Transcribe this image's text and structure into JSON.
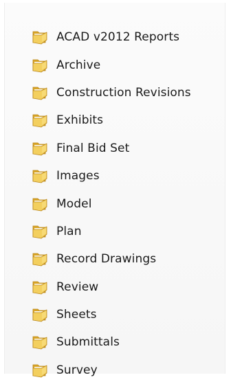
{
  "folders": [
    {
      "name": "ACAD v2012 Reports",
      "icon": "folder-icon"
    },
    {
      "name": "Archive",
      "icon": "folder-icon"
    },
    {
      "name": "Construction Revisions",
      "icon": "folder-icon"
    },
    {
      "name": "Exhibits",
      "icon": "folder-icon"
    },
    {
      "name": "Final Bid Set",
      "icon": "folder-icon"
    },
    {
      "name": "Images",
      "icon": "folder-icon"
    },
    {
      "name": "Model",
      "icon": "folder-icon"
    },
    {
      "name": "Plan",
      "icon": "folder-icon"
    },
    {
      "name": "Record Drawings",
      "icon": "folder-icon"
    },
    {
      "name": "Review",
      "icon": "folder-icon"
    },
    {
      "name": "Sheets",
      "icon": "folder-icon"
    },
    {
      "name": "Submittals",
      "icon": "folder-icon"
    },
    {
      "name": "Survey",
      "icon": "folder-icon"
    }
  ],
  "colors": {
    "folder_back": "#d9a527",
    "folder_front": "#f3cf5e",
    "folder_edge": "#b9861a",
    "text": "#1a1a1a"
  }
}
